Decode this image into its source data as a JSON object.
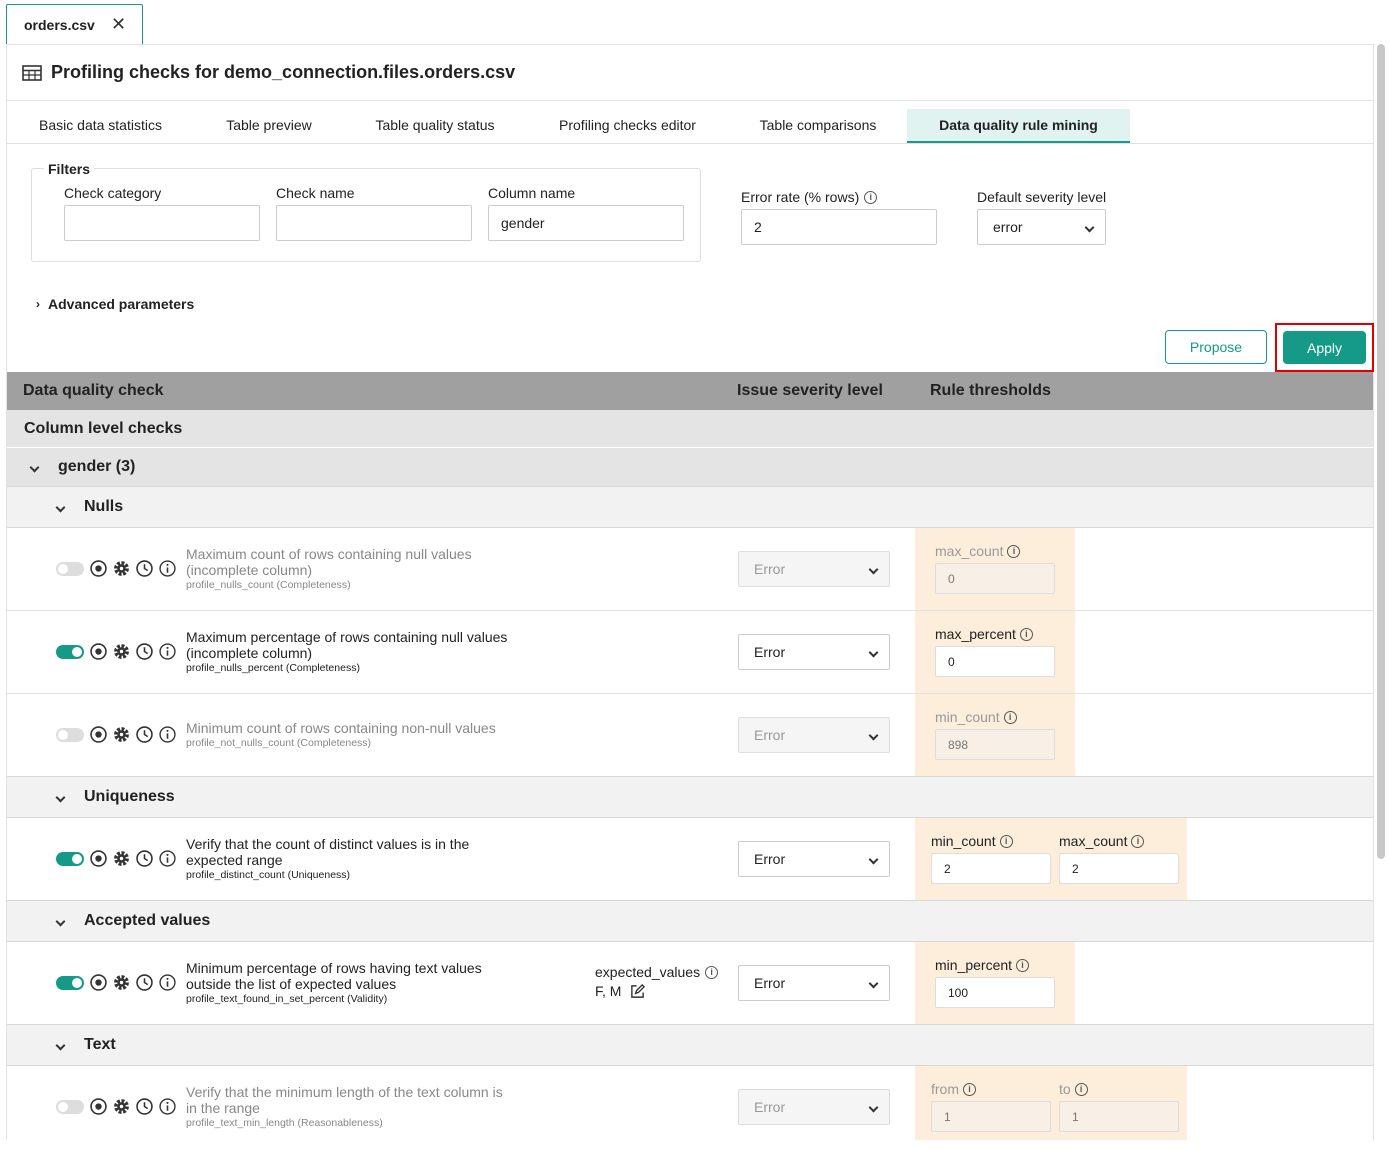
{
  "file_tab": {
    "label": "orders.csv",
    "close": "✕"
  },
  "page_title": "Profiling checks for demo_connection.files.orders.csv",
  "tabs": [
    "Basic data statistics",
    "Table preview",
    "Table quality status",
    "Profiling checks editor",
    "Table comparisons",
    "Data quality rule mining"
  ],
  "active_tab": "Data quality rule mining",
  "filters": {
    "legend": "Filters",
    "check_category": {
      "label": "Check category",
      "value": ""
    },
    "check_name": {
      "label": "Check name",
      "value": ""
    },
    "column_name": {
      "label": "Column name",
      "value": "gender"
    }
  },
  "error_rate": {
    "label": "Error rate (% rows)",
    "value": "2"
  },
  "default_severity": {
    "label": "Default severity level",
    "value": "error"
  },
  "advanced": "Advanced parameters",
  "buttons": {
    "propose": "Propose",
    "apply": "Apply"
  },
  "table_header": {
    "check": "Data quality check",
    "severity": "Issue severity level",
    "thresholds": "Rule thresholds"
  },
  "column_level": "Column level checks",
  "group": "gender (3)",
  "categories": {
    "nulls": "Nulls",
    "uniqueness": "Uniqueness",
    "accepted": "Accepted values",
    "text": "Text"
  },
  "checks": [
    {
      "title": "Maximum count of rows containing null values (incomplete column)",
      "name": "profile_nulls_count",
      "cat": "(Completeness)",
      "enabled": false,
      "severity": "Error",
      "params": [
        {
          "label": "max_count",
          "value": "0"
        }
      ]
    },
    {
      "title": "Maximum percentage of rows containing null values (incomplete column)",
      "name": "profile_nulls_percent",
      "cat": "(Completeness)",
      "enabled": true,
      "severity": "Error",
      "params": [
        {
          "label": "max_percent",
          "value": "0"
        }
      ]
    },
    {
      "title": "Minimum count of rows containing non-null values",
      "name": "profile_not_nulls_count",
      "cat": "(Completeness)",
      "enabled": false,
      "severity": "Error",
      "params": [
        {
          "label": "min_count",
          "value": "898"
        }
      ]
    },
    {
      "title": "Verify that the count of distinct values is in the expected range",
      "name": "profile_distinct_count",
      "cat": "(Uniqueness)",
      "enabled": true,
      "severity": "Error",
      "params": [
        {
          "label": "min_count",
          "value": "2"
        },
        {
          "label": "max_count",
          "value": "2"
        }
      ]
    },
    {
      "title": "Minimum percentage of rows having text values outside the list of expected values",
      "name": "profile_text_found_in_set_percent",
      "cat": "(Validity)",
      "enabled": true,
      "severity": "Error",
      "extra_label": "expected_values",
      "extra_value": "F, M",
      "params": [
        {
          "label": "min_percent",
          "value": "100"
        }
      ]
    },
    {
      "title": "Verify that the minimum length of the text column is in the range",
      "name": "profile_text_min_length",
      "cat": "(Reasonableness)",
      "enabled": false,
      "severity": "Error",
      "params": [
        {
          "label": "from",
          "value": "1"
        },
        {
          "label": "to",
          "value": "1"
        }
      ]
    }
  ]
}
